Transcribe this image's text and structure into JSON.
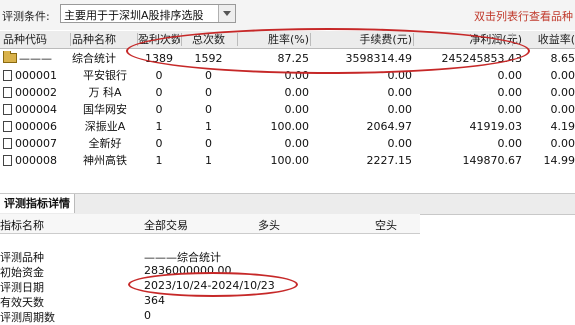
{
  "filter": {
    "label": "评测条件:",
    "selected": "主要用于于深圳A股排序选股",
    "hint": "双击列表行查看品种"
  },
  "table": {
    "headers": [
      "品种代码",
      "品种名称",
      "盈利次数",
      "总次数",
      "胜率(%)",
      "手续费(元)",
      "净利润(元)",
      "收益率("
    ],
    "rows": [
      {
        "code": "———",
        "name": "综合统计",
        "wins": "1389",
        "total": "1592",
        "rate": "87.25",
        "fee": "3598314.49",
        "net": "245245853.43",
        "yield": "8.65"
      },
      {
        "code": "000001",
        "name": "平安银行",
        "wins": "0",
        "total": "0",
        "rate": "0.00",
        "fee": "0.00",
        "net": "0.00",
        "yield": "0.00"
      },
      {
        "code": "000002",
        "name": "万 科A",
        "wins": "0",
        "total": "0",
        "rate": "0.00",
        "fee": "0.00",
        "net": "0.00",
        "yield": "0.00"
      },
      {
        "code": "000004",
        "name": "国华网安",
        "wins": "0",
        "total": "0",
        "rate": "0.00",
        "fee": "0.00",
        "net": "0.00",
        "yield": "0.00"
      },
      {
        "code": "000006",
        "name": "深振业A",
        "wins": "1",
        "total": "1",
        "rate": "100.00",
        "fee": "2064.97",
        "net": "41919.03",
        "yield": "4.19"
      },
      {
        "code": "000007",
        "name": "全新好",
        "wins": "0",
        "total": "0",
        "rate": "0.00",
        "fee": "0.00",
        "net": "0.00",
        "yield": "0.00"
      },
      {
        "code": "000008",
        "name": "神州高铁",
        "wins": "1",
        "total": "1",
        "rate": "100.00",
        "fee": "2227.15",
        "net": "149870.67",
        "yield": "14.99"
      }
    ]
  },
  "detail": {
    "tab": "评测指标详情",
    "headers": [
      "指标名称",
      "全部交易",
      "多头",
      "空头"
    ],
    "rows": [
      {
        "key": "评测品种",
        "value": "———综合统计"
      },
      {
        "key": "初始资金",
        "value": "2836000000.00"
      },
      {
        "key": "评测日期",
        "value": "2023/10/24-2024/10/23"
      },
      {
        "key": "有效天数",
        "value": "364"
      },
      {
        "key": "评测周期数",
        "value": "0"
      }
    ]
  },
  "colors": {
    "highlight_circle": "#c62828",
    "hint_text": "#c0392b"
  }
}
